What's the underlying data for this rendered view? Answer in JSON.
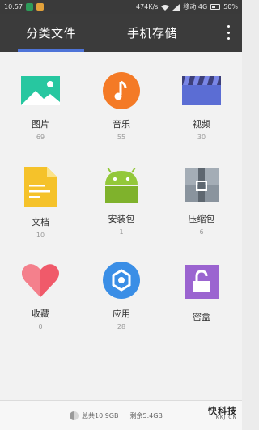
{
  "status_bar": {
    "time": "10:57",
    "network_speed": "474K/s",
    "carrier": "移动 4G",
    "battery": "50%",
    "icons": [
      "notification-green-icon",
      "notification-orange-icon",
      "wifi-icon",
      "signal-icon",
      "battery-icon"
    ]
  },
  "tabs": [
    {
      "label": "分类文件",
      "active": true
    },
    {
      "label": "手机存储",
      "active": false
    }
  ],
  "categories": [
    {
      "label": "图片",
      "count": "69",
      "icon": "picture-icon",
      "color": "#27c7a0"
    },
    {
      "label": "音乐",
      "count": "55",
      "icon": "music-icon",
      "color": "#f47a26"
    },
    {
      "label": "视频",
      "count": "30",
      "icon": "video-icon",
      "color": "#5b6dd4"
    },
    {
      "label": "文档",
      "count": "10",
      "icon": "document-icon",
      "color": "#f5c22a"
    },
    {
      "label": "安装包",
      "count": "1",
      "icon": "android-icon",
      "color": "#93c83a"
    },
    {
      "label": "压缩包",
      "count": "6",
      "icon": "archive-icon",
      "color": "#8a949e"
    },
    {
      "label": "收藏",
      "count": "0",
      "icon": "heart-icon",
      "color": "#f05a6a"
    },
    {
      "label": "应用",
      "count": "28",
      "icon": "app-hexagon-icon",
      "color": "#3a8ee6"
    },
    {
      "label": "密盒",
      "count": "",
      "icon": "lock-icon",
      "color": "#9b64d0"
    }
  ],
  "footer": {
    "total": "总共10.9GB",
    "free": "剩余5.4GB",
    "watermark": "快科技",
    "watermark_sub": "KKJ.CN"
  }
}
